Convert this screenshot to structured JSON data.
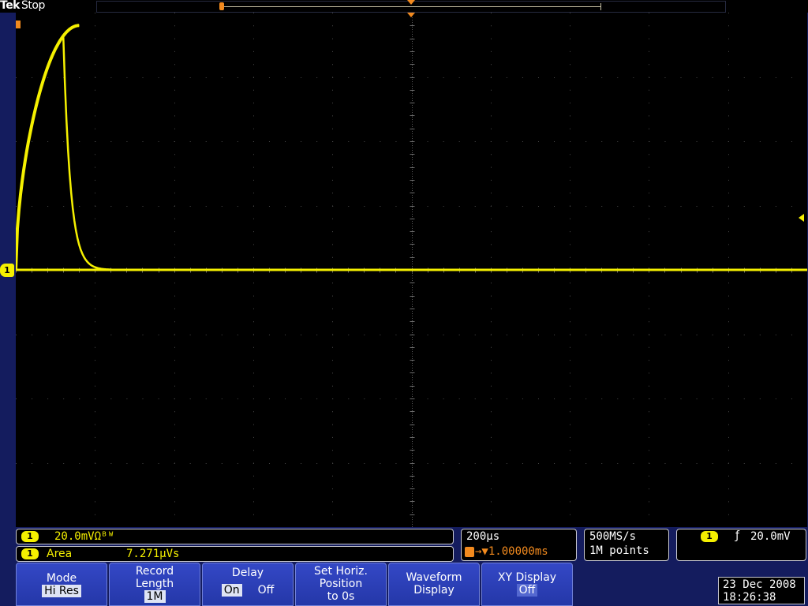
{
  "header": {
    "brand": "Tek",
    "state": "Stop"
  },
  "colors": {
    "ch1": "#f5f000",
    "accent": "#f28a1e",
    "menu": "#2a3db5",
    "background": "#141c5e"
  },
  "channel1": {
    "chip": "1",
    "scale": "20.0mVΩᴮᵂ",
    "measurement": {
      "chip": "1",
      "label": "Area",
      "value": "7.271µVs"
    }
  },
  "horizontal": {
    "scale": "200µs",
    "trigger_delay": "→▼1.00000ms"
  },
  "acquisition": {
    "sample_rate": "500MS/s",
    "record_points": "1M points"
  },
  "trigger": {
    "chip": "1",
    "slope": "ƒ",
    "level": "20.0mV"
  },
  "menu": {
    "mode": {
      "label": "Mode",
      "value": "Hi Res"
    },
    "record_length": {
      "label1": "Record",
      "label2": "Length",
      "value": "1M"
    },
    "delay": {
      "label": "Delay",
      "on": "On",
      "off": "Off"
    },
    "horiz_pos": {
      "label1": "Set Horiz.",
      "label2": "Position",
      "label3": "to 0s"
    },
    "waveform_display": {
      "label1": "Waveform",
      "label2": "Display"
    },
    "xy_display": {
      "label": "XY Display",
      "value": "Off"
    }
  },
  "datetime": {
    "date": "23 Dec 2008",
    "time": "18:26:38"
  },
  "chart_data": {
    "type": "line",
    "x_unit": "div",
    "y_unit": "div",
    "xlim": [
      0,
      10
    ],
    "ylim": [
      -4,
      4
    ],
    "baseline_div": 0,
    "series": [
      {
        "peak_time_div": 0.8,
        "cutoff_time_div": 10.0,
        "final_level_div": 0.22
      },
      {
        "peak_time_div": 0.8,
        "cutoff_time_div": 9.15,
        "final_level_div": 0.22
      },
      {
        "peak_time_div": 0.8,
        "cutoff_time_div": 4.78,
        "final_level_div": 0.22
      },
      {
        "peak_time_div": 0.8,
        "cutoff_time_div": 2.4,
        "final_level_div": 0.22
      },
      {
        "peak_time_div": 0.8,
        "cutoff_time_div": 1.1,
        "final_level_div": 0.22
      },
      {
        "peak_time_div": 0.8,
        "cutoff_time_div": 0.6,
        "final_level_div": 0.22
      }
    ],
    "peak_level_div": 3.8
  }
}
